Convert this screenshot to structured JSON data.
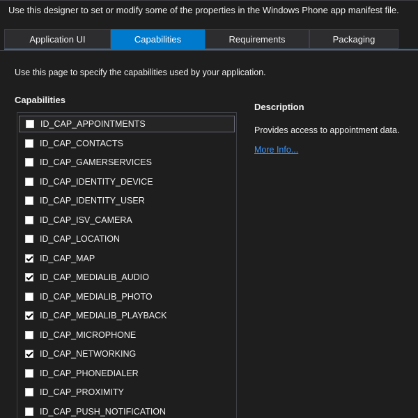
{
  "header": {
    "intro": "Use this designer to set or modify some of the properties in the Windows Phone app manifest file."
  },
  "tabs": [
    {
      "label": "Application UI",
      "active": false
    },
    {
      "label": "Capabilities",
      "active": true
    },
    {
      "label": "Requirements",
      "active": false
    },
    {
      "label": "Packaging",
      "active": false
    }
  ],
  "page": {
    "description": "Use this page to specify the capabilities used by your application.",
    "capabilities_title": "Capabilities"
  },
  "capabilities": [
    {
      "label": "ID_CAP_APPOINTMENTS",
      "checked": false,
      "selected": true
    },
    {
      "label": "ID_CAP_CONTACTS",
      "checked": false,
      "selected": false
    },
    {
      "label": "ID_CAP_GAMERSERVICES",
      "checked": false,
      "selected": false
    },
    {
      "label": "ID_CAP_IDENTITY_DEVICE",
      "checked": false,
      "selected": false
    },
    {
      "label": "ID_CAP_IDENTITY_USER",
      "checked": false,
      "selected": false
    },
    {
      "label": "ID_CAP_ISV_CAMERA",
      "checked": false,
      "selected": false
    },
    {
      "label": "ID_CAP_LOCATION",
      "checked": false,
      "selected": false
    },
    {
      "label": "ID_CAP_MAP",
      "checked": true,
      "selected": false
    },
    {
      "label": "ID_CAP_MEDIALIB_AUDIO",
      "checked": true,
      "selected": false
    },
    {
      "label": "ID_CAP_MEDIALIB_PHOTO",
      "checked": false,
      "selected": false
    },
    {
      "label": "ID_CAP_MEDIALIB_PLAYBACK",
      "checked": true,
      "selected": false
    },
    {
      "label": "ID_CAP_MICROPHONE",
      "checked": false,
      "selected": false
    },
    {
      "label": "ID_CAP_NETWORKING",
      "checked": true,
      "selected": false
    },
    {
      "label": "ID_CAP_PHONEDIALER",
      "checked": false,
      "selected": false
    },
    {
      "label": "ID_CAP_PROXIMITY",
      "checked": false,
      "selected": false
    },
    {
      "label": "ID_CAP_PUSH_NOTIFICATION",
      "checked": false,
      "selected": false
    }
  ],
  "description_panel": {
    "title": "Description",
    "text": "Provides access to appointment data.",
    "link": "More Info..."
  },
  "colors": {
    "accent": "#007acc",
    "background": "#1e1e1e",
    "link": "#3794ff"
  }
}
